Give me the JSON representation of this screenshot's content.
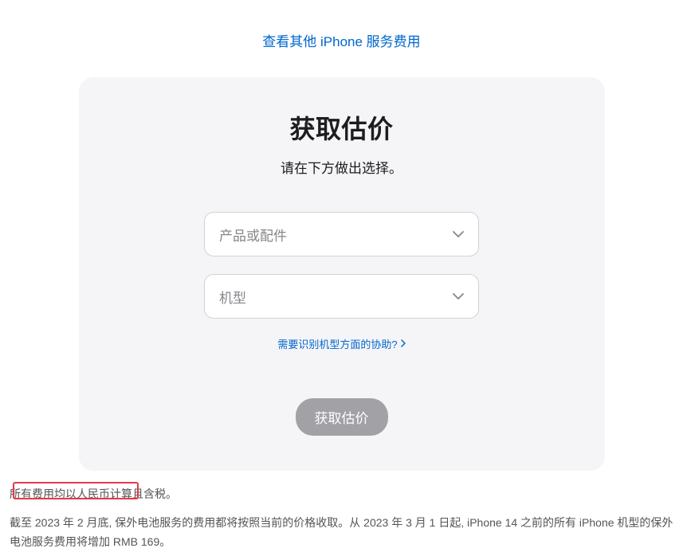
{
  "topLink": "查看其他 iPhone 服务费用",
  "card": {
    "title": "获取估价",
    "subtitle": "请在下方做出选择。",
    "select1": "产品或配件",
    "select2": "机型",
    "helpLink": "需要识别机型方面的协助?",
    "submitBtn": "获取估价"
  },
  "footerNote1": "所有费用均以人民币计算且含税。",
  "footerNote2": "截至 2023 年 2 月底, 保外电池服务的费用都将按照当前的价格收取。从 2023 年 3 月 1 日起, iPhone 14 之前的所有 iPhone 机型的保外电池服务费用将增加 RMB 169。"
}
